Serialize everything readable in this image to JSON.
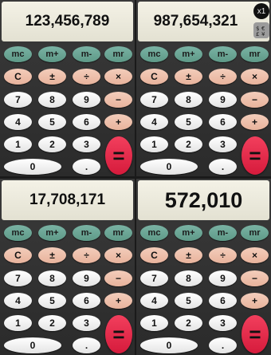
{
  "displays": [
    "123,456,789",
    "987,654,321",
    "17,708,171",
    "572,010"
  ],
  "memory_keys": [
    "mc",
    "m+",
    "m-",
    "mr"
  ],
  "function_row": [
    "C",
    "±",
    "÷",
    "×"
  ],
  "digit_rows": [
    [
      "7",
      "8",
      "9"
    ],
    [
      "4",
      "5",
      "6"
    ],
    [
      "1",
      "2",
      "3"
    ]
  ],
  "side_ops": [
    "−",
    "+"
  ],
  "zero_label": "0",
  "dot_label": ".",
  "equals_label": "=",
  "top_right_badge": "x1",
  "icons": {
    "currency": "currency-exchange-icon"
  },
  "colors": {
    "memory": "#6aa392",
    "function": "#efc1ab",
    "digit": "#f3f3f3",
    "equals": "#e72848",
    "display": "#efede0"
  }
}
